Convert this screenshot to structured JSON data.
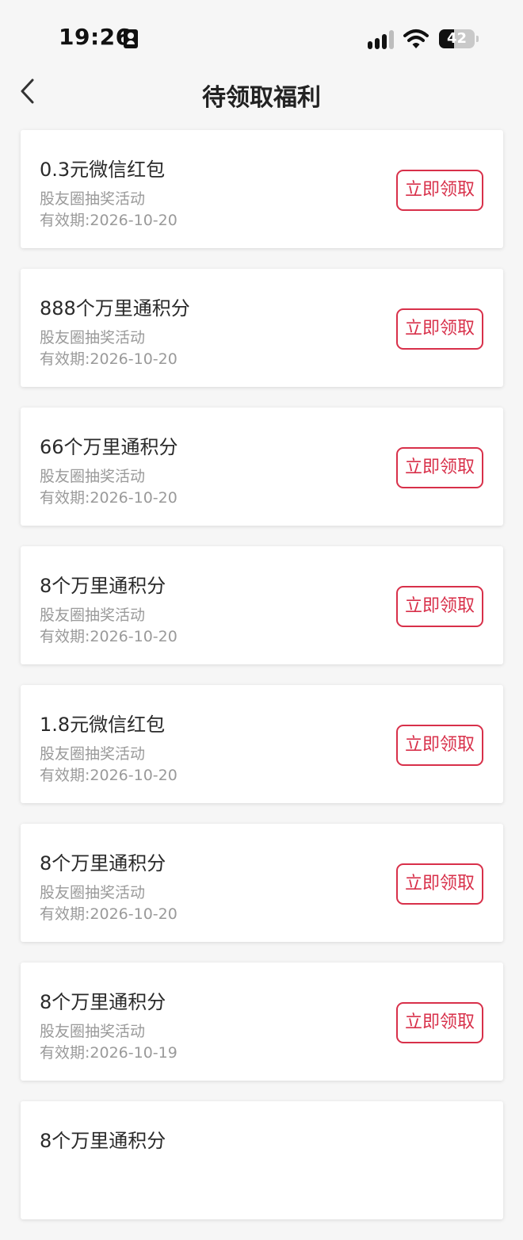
{
  "status_bar": {
    "time": "19:26",
    "battery_level": "42",
    "icons": [
      "contact-card-icon",
      "cellular-signal-icon",
      "wifi-icon",
      "battery-icon"
    ]
  },
  "header": {
    "title": "待领取福利",
    "back_icon": "chevron-left-icon"
  },
  "theme": {
    "accent_color": "#d8304a",
    "background": "#f6f6f6",
    "card_background": "#ffffff",
    "muted_text": "#9a9a9a"
  },
  "rewards": [
    {
      "title": "0.3元微信红包",
      "source": "股友圈抽奖活动",
      "expiry": "有效期:2026-10-20",
      "action": "立即领取"
    },
    {
      "title": "888个万里通积分",
      "source": "股友圈抽奖活动",
      "expiry": "有效期:2026-10-20",
      "action": "立即领取"
    },
    {
      "title": "66个万里通积分",
      "source": "股友圈抽奖活动",
      "expiry": "有效期:2026-10-20",
      "action": "立即领取"
    },
    {
      "title": "8个万里通积分",
      "source": "股友圈抽奖活动",
      "expiry": "有效期:2026-10-20",
      "action": "立即领取"
    },
    {
      "title": "1.8元微信红包",
      "source": "股友圈抽奖活动",
      "expiry": "有效期:2026-10-20",
      "action": "立即领取"
    },
    {
      "title": "8个万里通积分",
      "source": "股友圈抽奖活动",
      "expiry": "有效期:2026-10-20",
      "action": "立即领取"
    },
    {
      "title": "8个万里通积分",
      "source": "股友圈抽奖活动",
      "expiry": "有效期:2026-10-19",
      "action": "立即领取"
    },
    {
      "title": "8个万里通积分",
      "source": "",
      "expiry": "",
      "action": ""
    }
  ]
}
